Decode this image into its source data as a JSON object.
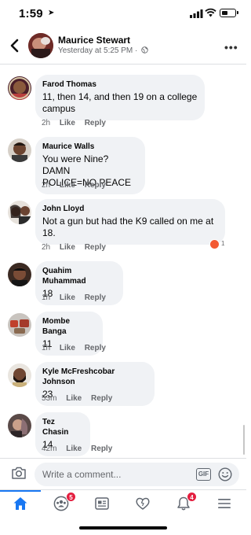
{
  "status_bar": {
    "time": "1:59",
    "location_icon": "location-arrow-icon"
  },
  "header": {
    "name": "Maurice Stewart",
    "meta": "Yesterday at 5:25 PM ·",
    "privacy_icon": "globe-icon",
    "back_icon": "chevron-left-icon",
    "more_icon": "more-horizontal-icon"
  },
  "comments": [
    {
      "name": "Farod Thomas",
      "text": "11, then 14, and then 19 on a college\ncampus",
      "time": "2h",
      "like": "Like",
      "reply": "Reply"
    },
    {
      "name": "Maurice Walls",
      "text": "You were Nine? DAMN\nPOLICE=NO PEACE",
      "time": "2h",
      "like": "Like",
      "reply": "Reply"
    },
    {
      "name": "John Lloyd",
      "text": "Not a gun but had the K9 called on me at\n18.",
      "time": "2h",
      "like": "Like",
      "reply": "Reply",
      "reaction_count": "1",
      "reaction_icon": "angry-face-icon"
    },
    {
      "name": "Quahim Muhammad",
      "text": "18",
      "time": "1h",
      "like": "Like",
      "reply": "Reply"
    },
    {
      "name": "Mombe Banga",
      "text": "11",
      "time": "1h",
      "like": "Like",
      "reply": "Reply"
    },
    {
      "name": "Kyle McFreshcobar Johnson",
      "text": "23",
      "time": "53m",
      "like": "Like",
      "reply": "Reply"
    },
    {
      "name": "Tez Chasin",
      "text": "14",
      "time": "42m",
      "like": "Like",
      "reply": "Reply"
    }
  ],
  "composer": {
    "placeholder": "Write a comment...",
    "gif_label": "GIF"
  },
  "tabbar": {
    "tabs": [
      {
        "name": "home",
        "icon": "home-icon",
        "active": true
      },
      {
        "name": "groups",
        "icon": "groups-icon",
        "badge": "5"
      },
      {
        "name": "news",
        "icon": "news-feed-icon"
      },
      {
        "name": "dating",
        "icon": "heart-icon"
      },
      {
        "name": "notifications",
        "icon": "bell-icon",
        "badge": "4"
      },
      {
        "name": "menu",
        "icon": "menu-icon"
      }
    ]
  },
  "colors": {
    "accent": "#1877f2",
    "badge": "#e41e3f",
    "bubble": "#f0f2f5",
    "muted": "#65676b"
  }
}
